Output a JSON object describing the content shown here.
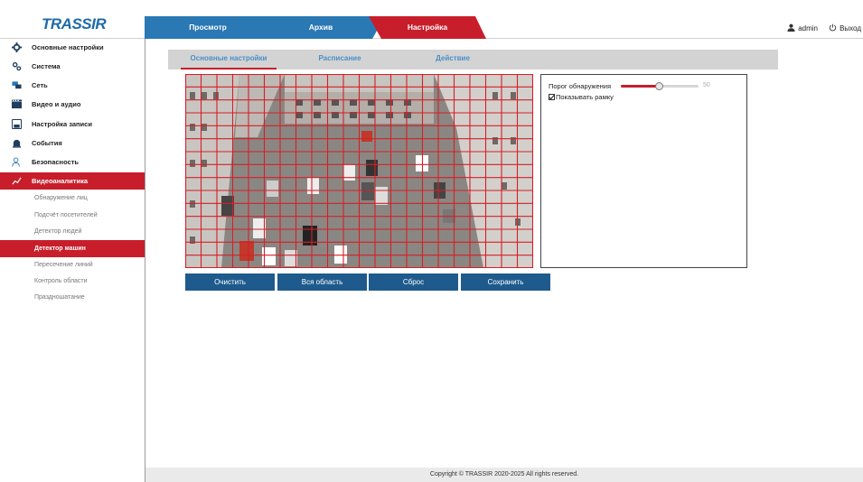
{
  "header": {
    "logo_text": "TRASSIR",
    "tabs": [
      {
        "label": "Просмотр"
      },
      {
        "label": "Архив"
      },
      {
        "label": "Настройка"
      }
    ],
    "user": "admin",
    "logout": "Выход"
  },
  "sidebar": {
    "items": [
      {
        "label": "Основные настройки",
        "icon": "gear-icon"
      },
      {
        "label": "Система",
        "icon": "gears-icon"
      },
      {
        "label": "Сеть",
        "icon": "network-icon"
      },
      {
        "label": "Видео и аудио",
        "icon": "film-icon"
      },
      {
        "label": "Настройка записи",
        "icon": "disk-icon"
      },
      {
        "label": "События",
        "icon": "alarm-icon"
      },
      {
        "label": "Безопасность",
        "icon": "user-shield-icon"
      },
      {
        "label": "Видеоаналитика",
        "icon": "analytics-icon"
      }
    ],
    "subitems": [
      {
        "label": "Обнаружение лиц"
      },
      {
        "label": "Подсчёт посетителей"
      },
      {
        "label": "Детектор людей"
      },
      {
        "label": "Детектор машин"
      },
      {
        "label": "Пересечение линий"
      },
      {
        "label": "Контроль области"
      },
      {
        "label": "Праздношатание"
      }
    ],
    "active_subitem": "Детектор машин"
  },
  "subtabs": [
    {
      "label": "Основные настройки"
    },
    {
      "label": "Расписание"
    },
    {
      "label": "Действие"
    }
  ],
  "settings_panel": {
    "threshold_label": "Порог обнаружения",
    "threshold_value": "50",
    "threshold_fraction": 0.5,
    "show_frame_label": "Показывать рамку",
    "show_frame_checked": true
  },
  "buttons": {
    "clear": "Очистить",
    "all_area": "Вся область",
    "reset": "Сброс",
    "save": "Сохранить"
  },
  "footer": "Copyright © TRASSIR 2020-2025 All rights reserved.",
  "colors": {
    "accent_red": "#c81e2b",
    "tab_blue": "#2a78b4",
    "button_blue": "#1e5b8c",
    "grid_red": "#d61f26"
  }
}
